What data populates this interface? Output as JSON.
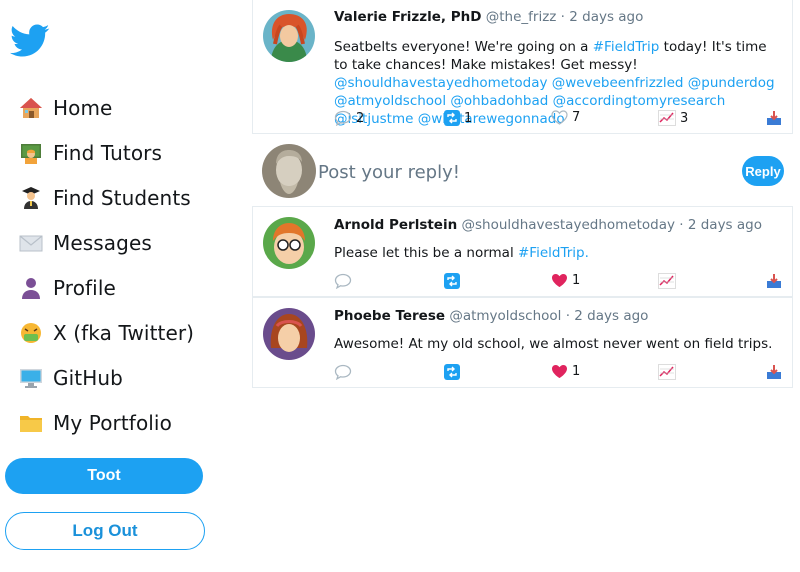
{
  "sidebar": {
    "items": [
      {
        "label": "Home",
        "icon": "house-icon"
      },
      {
        "label": "Find Tutors",
        "icon": "teacher-icon"
      },
      {
        "label": "Find Students",
        "icon": "student-icon"
      },
      {
        "label": "Messages",
        "icon": "envelope-icon"
      },
      {
        "label": "Profile",
        "icon": "person-icon"
      },
      {
        "label": "X (fka Twitter)",
        "icon": "sick-face-icon"
      },
      {
        "label": "GitHub",
        "icon": "computer-icon"
      },
      {
        "label": "My Portfolio",
        "icon": "folder-icon"
      }
    ],
    "toot_label": "Toot",
    "logout_label": "Log Out"
  },
  "main_tweet": {
    "name": "Valerie Frizzle, PhD",
    "handle": "@the_frizz",
    "time": " · 2 days ago",
    "text_plain": "Seatbelts everyone! We're going on a ",
    "hashtag": "#FieldTrip",
    "text_plain2": " today! It's time to take chances! Make mistakes! Get messy! ",
    "mentions": "@shouldhavestayedhometoday @wevebeenfrizzled @punderdog @atmyoldschool @ohbadohbad @accordingtomyresearch @isitjustme @whatarewegonnado",
    "replies": "2",
    "retweets": "1",
    "likes": "7",
    "stats": "3"
  },
  "reply_box": {
    "placeholder": "Post your reply!",
    "button_label": "Reply"
  },
  "replies": [
    {
      "name": "Arnold Perlstein",
      "handle": "@shouldhavestayedhometoday",
      "time": " · 2 days ago",
      "text_plain": "Please let this be a normal ",
      "hashtag": "#FieldTrip.",
      "likes": "1"
    },
    {
      "name": "Phoebe Terese",
      "handle": "@atmyoldschool",
      "time": " · 2 days ago",
      "text_plain": "Awesome! At my old school, we almost never went on field trips.",
      "likes": "1"
    }
  ],
  "colors": {
    "accent": "#1da1f2",
    "heart": "#e0245e",
    "border": "#e6ecf0"
  }
}
